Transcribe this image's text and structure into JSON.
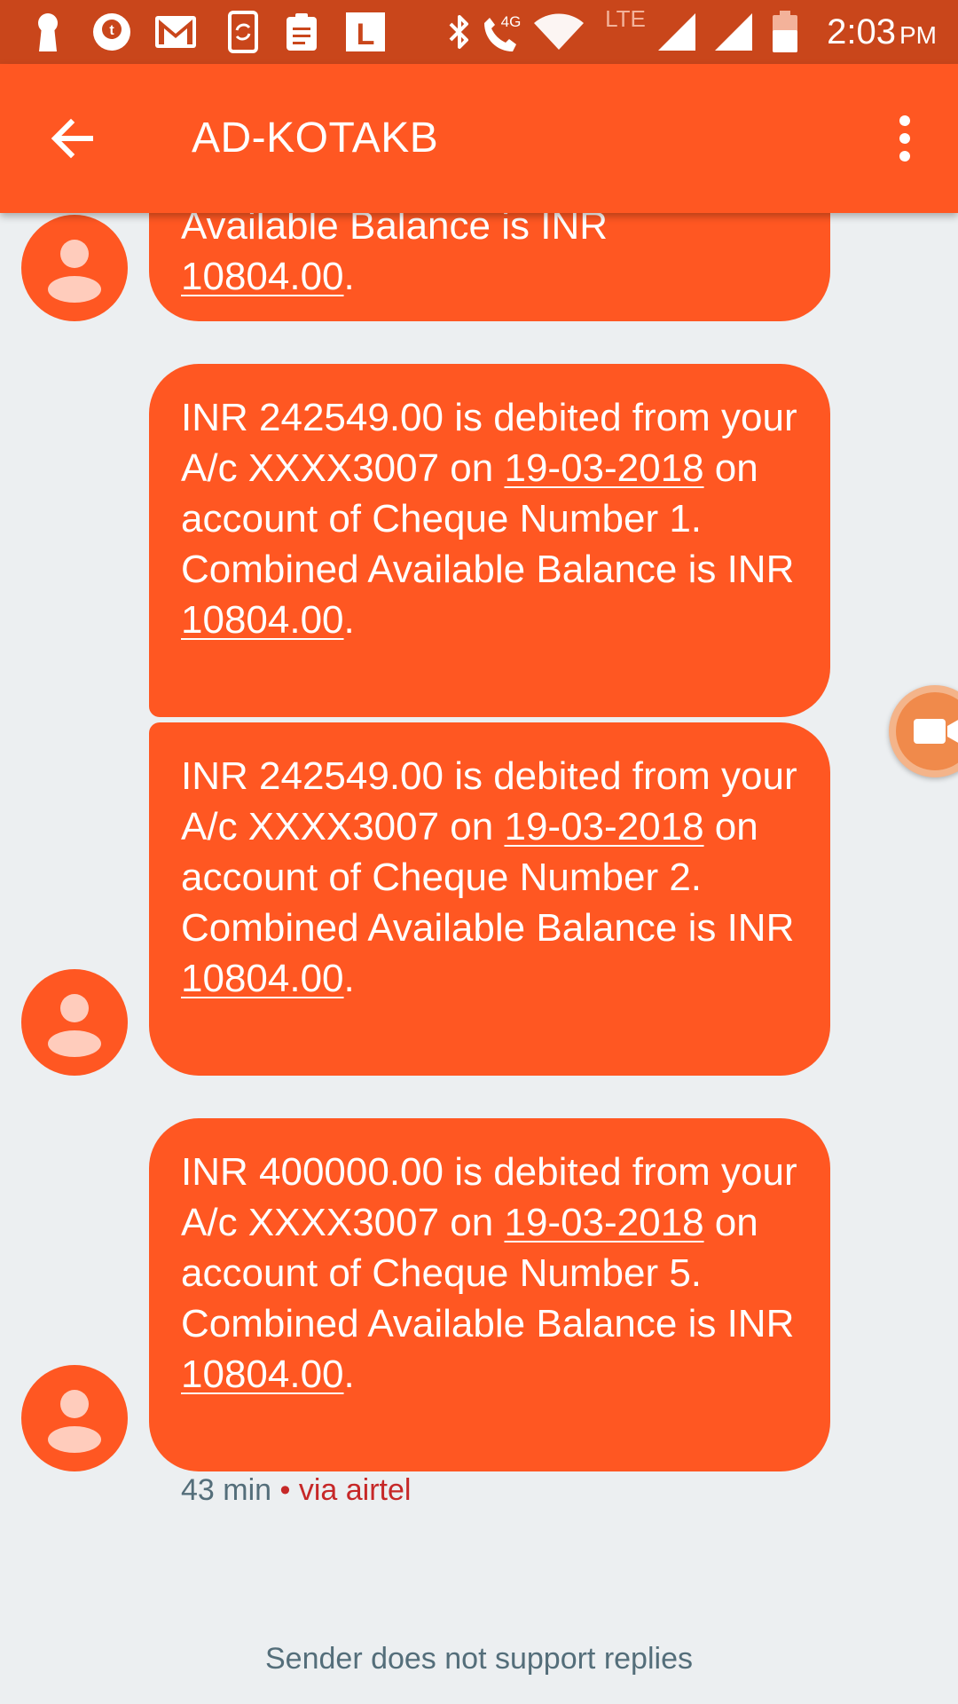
{
  "status_bar": {
    "time": "2:03",
    "ampm": "PM",
    "network_4g": "4G",
    "network_lte": "LTE",
    "icons": [
      "keyhole-icon",
      "tata-app-icon",
      "gmail-icon",
      "phone-sync-icon",
      "clipboard-icon",
      "l-app-icon",
      "bluetooth-icon",
      "volte-call-icon",
      "wifi-icon",
      "signal-icon",
      "signal-icon",
      "battery-icon"
    ]
  },
  "app_bar": {
    "title": "AD-KOTAKB",
    "back_icon": "arrow-back-icon",
    "menu_icon": "more-vert-icon"
  },
  "messages": [
    {
      "line1": "Available Balance is INR",
      "balance": "10804.00",
      "period": "."
    },
    {
      "prefix": "INR 242549.00 is debited from your A/c XXXX3007 on ",
      "date": "19-03-2018",
      "middle": " on account of Cheque Number 1. Combined Available Balance is INR ",
      "balance": "10804.00",
      "period": "."
    },
    {
      "prefix": "INR 242549.00 is debited from your A/c XXXX3007 on ",
      "date": "19-03-2018",
      "middle": " on account of Cheque Number 2. Combined Available Balance is INR ",
      "balance": "10804.00",
      "period": "."
    },
    {
      "prefix": "INR 400000.00 is debited from your A/c XXXX3007 on ",
      "date": "19-03-2018",
      "middle": " on account of Cheque Number 5. Combined Available Balance is INR ",
      "balance": "10804.00",
      "period": "."
    }
  ],
  "meta": {
    "time_ago": "43 min",
    "separator": " • ",
    "via": "via airtel"
  },
  "footer_note": "Sender does not support replies",
  "colors": {
    "status_bar": "#c9461b",
    "app_bar": "#ff5722",
    "bubble": "#ff5722",
    "background": "#eceff1",
    "meta_text": "#546e7a",
    "via_text": "#c62828"
  }
}
